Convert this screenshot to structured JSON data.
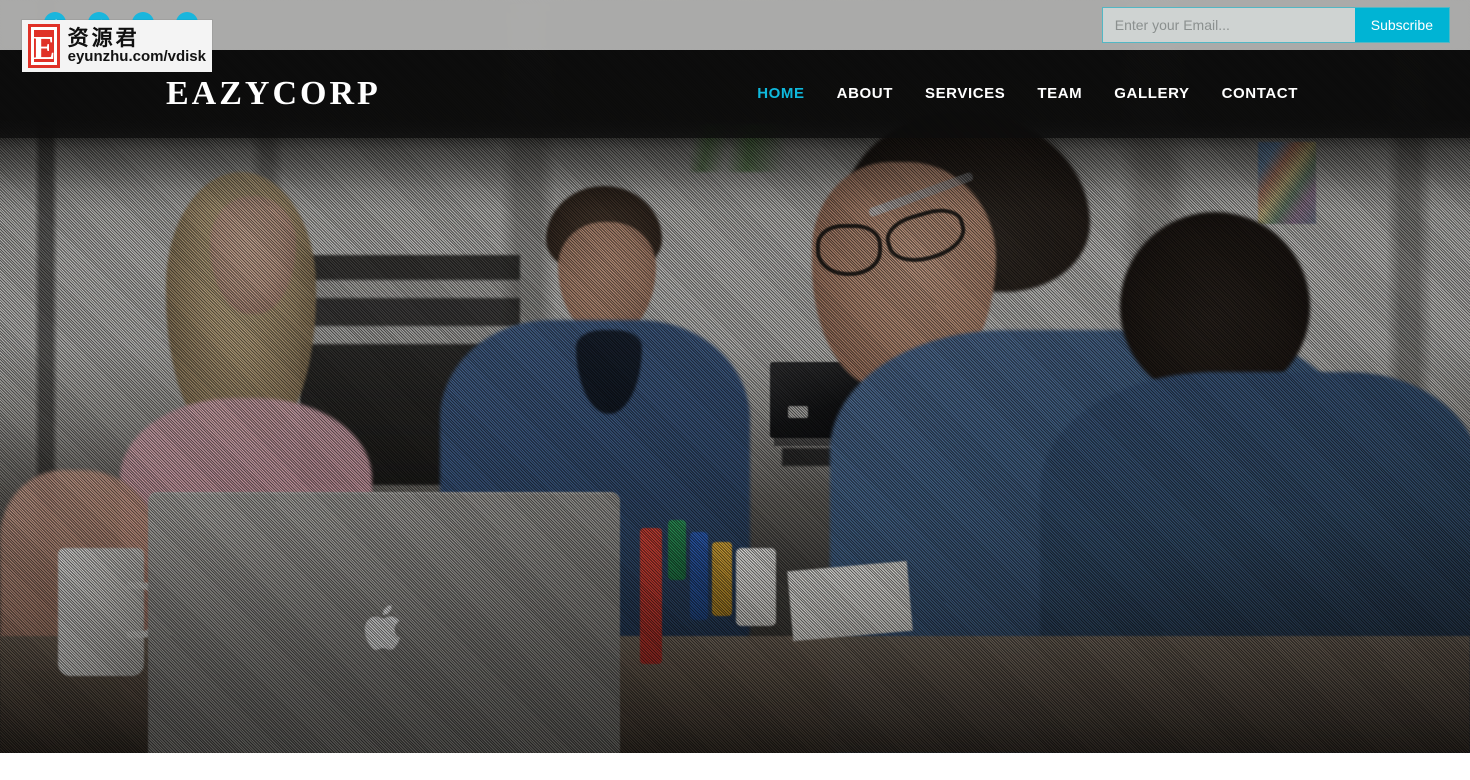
{
  "site": {
    "brand": "EAZYCORP"
  },
  "topbar": {
    "social": [
      {
        "name": "facebook-icon",
        "glyph": "f"
      },
      {
        "name": "twitter-icon",
        "glyph": "t"
      },
      {
        "name": "google-plus-icon",
        "glyph": "g"
      },
      {
        "name": "linkedin-icon",
        "glyph": "in"
      }
    ],
    "subscribe": {
      "placeholder": "Enter your Email...",
      "value": "",
      "button_label": "Subscribe"
    },
    "accent_color": "#00b4d4",
    "background_color": "#e8e8e6"
  },
  "nav": {
    "items": [
      {
        "label": "HOME",
        "active": true
      },
      {
        "label": "ABOUT",
        "active": false
      },
      {
        "label": "SERVICES",
        "active": false
      },
      {
        "label": "TEAM",
        "active": false
      },
      {
        "label": "GALLERY",
        "active": false
      },
      {
        "label": "CONTACT",
        "active": false
      }
    ],
    "active_color": "#0fb9dd",
    "link_color": "#ffffff",
    "background_color": "rgba(12,12,12,0.80)"
  },
  "hero": {
    "image_description": "Office team meeting around a table with a MacBook laptop",
    "overlay_pattern": "diagonal-hatch"
  },
  "watermark": {
    "badge_letter": "E",
    "chinese_text": "资源君",
    "url_text": "eyunzhu.com/vdisk",
    "badge_color": "#e03127"
  }
}
